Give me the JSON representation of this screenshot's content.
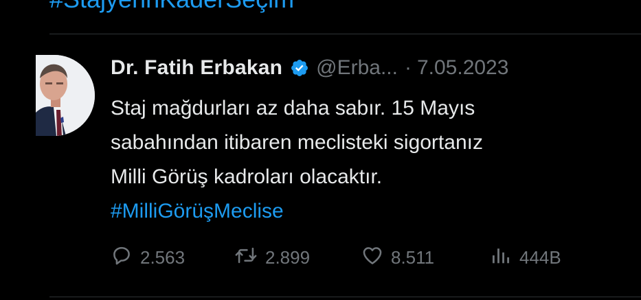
{
  "previous_tweet": {
    "hashtag_fragment": "#StajyerinKaderSeçim"
  },
  "tweet": {
    "author_name": "Dr. Fatih Erbakan",
    "handle": "@Erba...",
    "separator": "·",
    "date": "7.05.2023",
    "text_lines": [
      "Staj mağdurları az daha sabır. 15 Mayıs",
      "sabahından itibaren meclisteki sigortanız",
      "Milli Görüş kadroları olacaktır."
    ],
    "hashtag": "#MilliGörüşMeclise"
  },
  "actions": {
    "replies": "2.563",
    "retweets": "2.899",
    "likes": "8.511",
    "views": "444B"
  },
  "icons": {
    "verified": "verified-badge-icon",
    "reply": "comment-icon",
    "retweet": "retweet-icon",
    "like": "heart-icon",
    "views": "analytics-icon"
  },
  "colors": {
    "background": "#000000",
    "text": "#e7e9ea",
    "muted": "#71767b",
    "accent": "#1d9bf0",
    "divider": "#2f3336"
  }
}
